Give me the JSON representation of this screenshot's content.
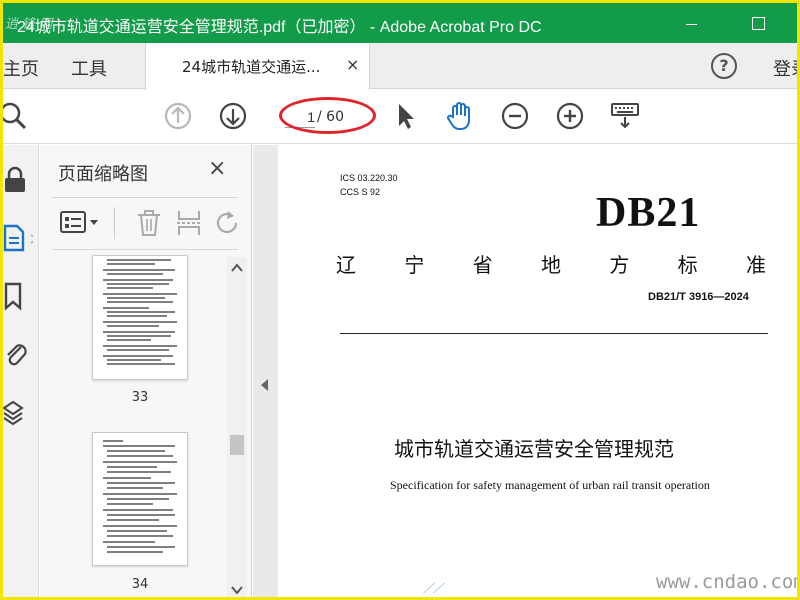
{
  "window": {
    "title": "24城市轨道交通运营安全管理规范.pdf（已加密） - Adobe Acrobat Pro DC",
    "brand_overlay": "逍 锋 网",
    "colors": {
      "titlebar": "#129b48",
      "highlight": "#e0242b",
      "frame": "#f0e600"
    }
  },
  "menu": {
    "home": "主页",
    "tools": "工具",
    "document_tab": "24城市轨道交通运...",
    "tab_close": "×",
    "help": "?",
    "login": "登录"
  },
  "toolbar": {
    "current_page": "1",
    "total_pages": "/ 60",
    "icons": [
      "search-icon",
      "page-up-icon",
      "page-down-icon",
      "select-arrow-icon",
      "hand-icon",
      "zoom-out-icon",
      "zoom-in-icon",
      "keyboard-icon"
    ]
  },
  "rail": {
    "icons": [
      "lock-icon",
      "page-thumbnails-icon",
      "bookmark-icon",
      "attachment-icon",
      "layers-icon"
    ]
  },
  "thumbnails_panel": {
    "title": "页面缩略图",
    "close": "×",
    "pages": [
      {
        "number": "33"
      },
      {
        "number": "34"
      }
    ]
  },
  "document": {
    "ics": "ICS  03.220.30",
    "ccs": "CCS  S 92",
    "code": "DB21",
    "province_chars": [
      "辽",
      "宁",
      "省",
      "地",
      "方",
      "标",
      "准"
    ],
    "standard_number": "DB21/T 3916—2024",
    "title_cn": "城市轨道交通运营安全管理规范",
    "title_en": "Specification for safety management of urban rail transit operation",
    "watermark": "www.cndao.com"
  }
}
